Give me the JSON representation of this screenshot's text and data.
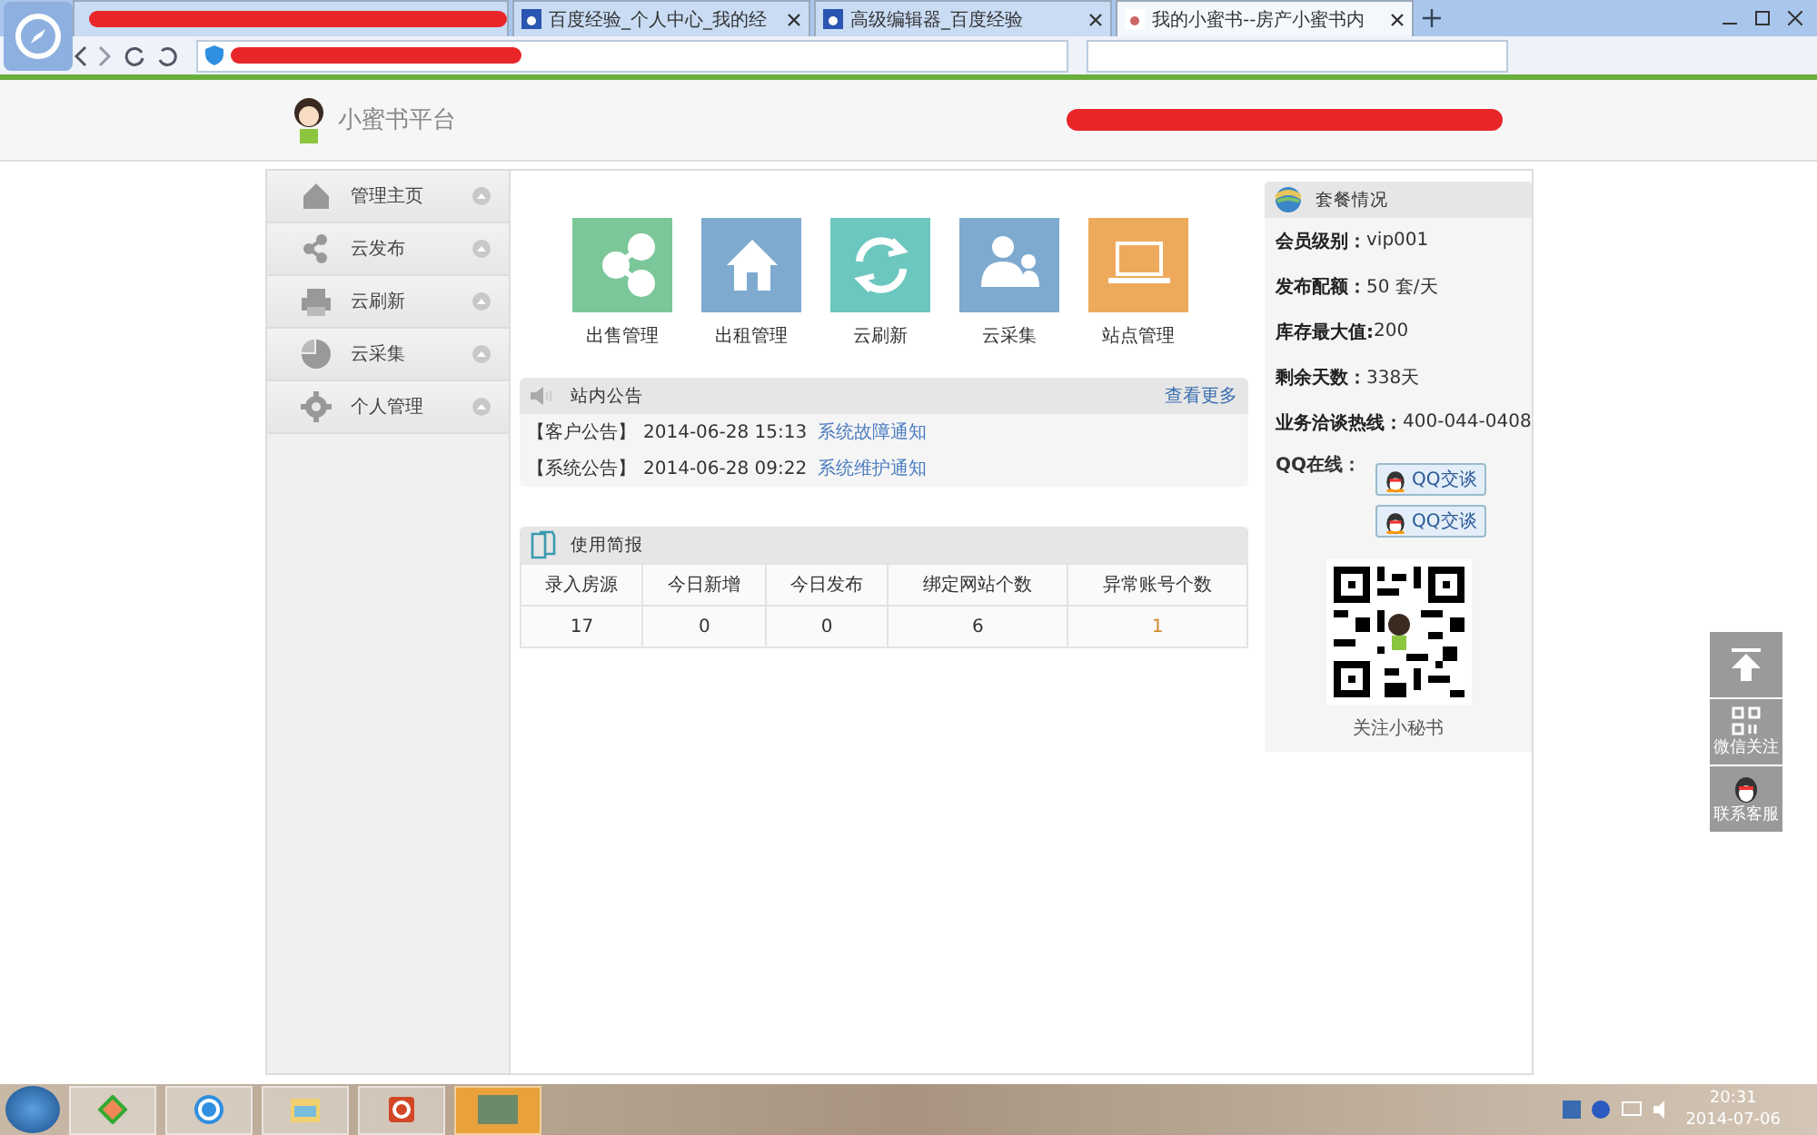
{
  "browser": {
    "tabs": [
      {
        "selected": false
      },
      {
        "title": "百度经验_个人中心_我的经",
        "selected": false
      },
      {
        "title": "高级编辑器_百度经验",
        "selected": false
      },
      {
        "title": "我的小蜜书--房产小蜜书内",
        "selected": true
      }
    ]
  },
  "site": {
    "logo_text": "小蜜书平台"
  },
  "sidebar": {
    "items": [
      {
        "label": "管理主页",
        "kind": "home"
      },
      {
        "label": "云发布",
        "kind": "share"
      },
      {
        "label": "云刷新",
        "kind": "printer"
      },
      {
        "label": "云采集",
        "kind": "pie"
      },
      {
        "label": "个人管理",
        "kind": "gear"
      }
    ]
  },
  "tiles": [
    {
      "label": "出售管理",
      "kind": "share",
      "color": "#7cc79a"
    },
    {
      "label": "出租管理",
      "kind": "home",
      "color": "#7eaacf"
    },
    {
      "label": "云刷新",
      "kind": "refresh",
      "color": "#6cc7bf"
    },
    {
      "label": "云采集",
      "kind": "people",
      "color": "#7eaacf"
    },
    {
      "label": "站点管理",
      "kind": "laptop",
      "color": "#eeaa5c"
    }
  ],
  "notices": {
    "title": "站内公告",
    "more": "查看更多",
    "items": [
      {
        "tag": "【客户公告】",
        "date": "2014-06-28 15:13",
        "link": "系统故障通知"
      },
      {
        "tag": "【系统公告】",
        "date": "2014-06-28 09:22",
        "link": "系统维护通知"
      }
    ]
  },
  "report": {
    "title": "使用简报",
    "columns": [
      "录入房源",
      "今日新增",
      "今日发布",
      "绑定网站个数",
      "异常账号个数"
    ],
    "cells": [
      {
        "text": "17",
        "warning": false
      },
      {
        "text": "0",
        "warning": false
      },
      {
        "text": "0",
        "warning": false
      },
      {
        "text": "6",
        "warning": false
      },
      {
        "text": "1",
        "warning": true
      }
    ]
  },
  "package": {
    "title": "套餐情况",
    "fields": [
      {
        "label": "会员级别：",
        "value": "vip001"
      },
      {
        "label": "发布配额：",
        "value": "50 套/天"
      },
      {
        "label": "库存最大值:",
        "value": "200"
      },
      {
        "label": "剩余天数：",
        "value": "338天"
      },
      {
        "label": "业务洽谈热线：",
        "value": "400-044-0408"
      }
    ],
    "qq_label": "QQ在线：",
    "qq_buttons": [
      "QQ交谈",
      "QQ交谈"
    ],
    "qr_caption": "关注小秘书"
  },
  "float_buttons": [
    {
      "kind": "top"
    },
    {
      "kind": "qr",
      "label": "微信关注"
    },
    {
      "kind": "qq",
      "label": "联系客服"
    }
  ],
  "taskbar": {
    "time": "20:31",
    "date": "2014-07-06"
  }
}
